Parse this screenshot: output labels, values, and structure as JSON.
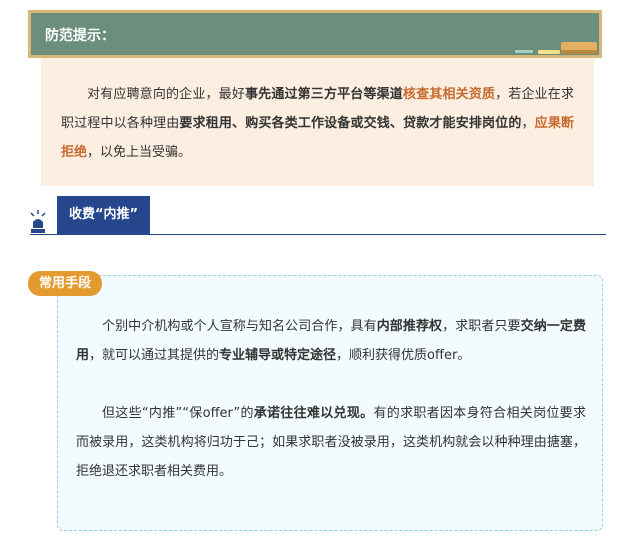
{
  "notice": {
    "title": "防范提示：",
    "segments": [
      {
        "text": "对有应聘意向的企业，最好",
        "style": "normal"
      },
      {
        "text": "事先通过第三方平台等渠道",
        "style": "bold"
      },
      {
        "text": "核查其相关资质",
        "style": "orange"
      },
      {
        "text": "，若企业在求职过程中以各种理由",
        "style": "normal"
      },
      {
        "text": "要求租用、购买各类工作设备或交钱、贷款才能安排岗位的",
        "style": "bold"
      },
      {
        "text": "，",
        "style": "normal"
      },
      {
        "text": "应果断拒绝",
        "style": "orange"
      },
      {
        "text": "，以免上当受骗。",
        "style": "normal"
      }
    ]
  },
  "section": {
    "title": "收费“内推”"
  },
  "methods": {
    "label": "常用手段",
    "paragraphs": [
      {
        "segments": [
          {
            "text": "个别中介机构或个人宣称与知名公司合作，具有",
            "style": "normal"
          },
          {
            "text": "内部推荐权",
            "style": "bold"
          },
          {
            "text": "，求职者只要",
            "style": "normal"
          },
          {
            "text": "交纳一定费用",
            "style": "bold"
          },
          {
            "text": "，就可以通过其提供的",
            "style": "normal"
          },
          {
            "text": "专业辅导或特定途径",
            "style": "bold"
          },
          {
            "text": "，顺利获得优质offer。",
            "style": "normal"
          }
        ]
      },
      {
        "segments": [
          {
            "text": "但这些“内推”“保offer”的",
            "style": "normal"
          },
          {
            "text": "承诺往往难以兑现。",
            "style": "bold"
          },
          {
            "text": "有的求职者因本身符合相关岗位要求而被录用，这类机构将归功于己；如果求职者没被录用，这类机构就会以种种理由搪塞，拒绝退还求职者相关费用。",
            "style": "normal"
          }
        ]
      }
    ]
  }
}
